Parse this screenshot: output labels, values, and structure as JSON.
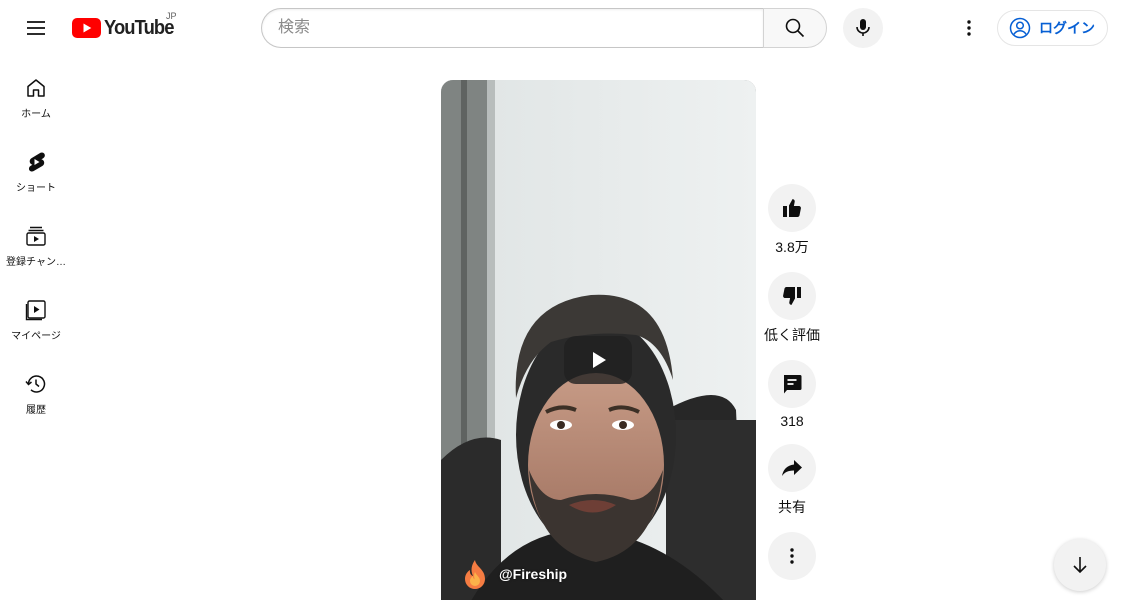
{
  "header": {
    "logo_text": "YouTube",
    "logo_country": "JP",
    "search_placeholder": "検索",
    "search_value": "",
    "login_label": "ログイン",
    "brand_color": "#ff0000",
    "link_color": "#065fd4"
  },
  "sidebar": {
    "items": [
      {
        "label": "ホーム",
        "icon": "home-icon"
      },
      {
        "label": "ショート",
        "icon": "shorts-icon"
      },
      {
        "label": "登録チャン…",
        "icon": "subscriptions-icon"
      },
      {
        "label": "マイページ",
        "icon": "library-icon"
      },
      {
        "label": "履歴",
        "icon": "history-icon"
      }
    ]
  },
  "video": {
    "channel_handle": "@Fireship"
  },
  "actions": {
    "like_count": "3.8万",
    "dislike_label": "低く評価",
    "comment_count": "318",
    "share_label": "共有"
  }
}
